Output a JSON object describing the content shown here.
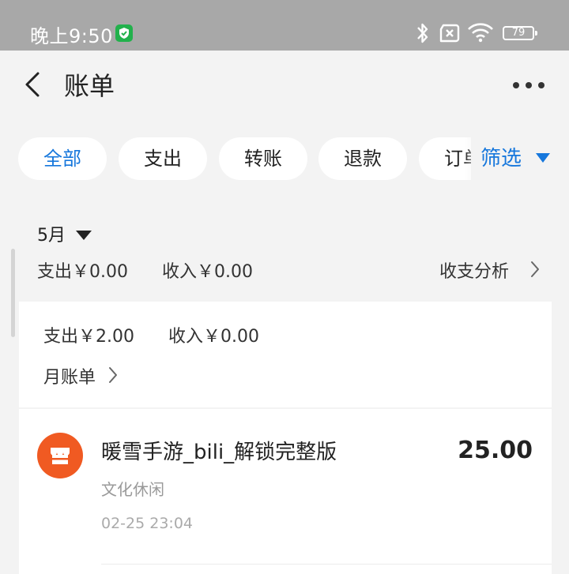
{
  "status_bar": {
    "time": "晚上9:50",
    "battery": "79",
    "icons": [
      "shield-icon",
      "bluetooth-icon",
      "no-sim-icon",
      "wifi-icon",
      "battery-icon"
    ]
  },
  "header": {
    "title": "账单",
    "icons": [
      "back-arrow-icon",
      "more-dots-icon"
    ]
  },
  "tabs": [
    {
      "label": "全部",
      "active": true
    },
    {
      "label": "支出",
      "active": false
    },
    {
      "label": "转账",
      "active": false
    },
    {
      "label": "退款",
      "active": false
    },
    {
      "label": "订单",
      "active": false
    }
  ],
  "filter": {
    "label": "筛选",
    "icon": "triangle-down-icon"
  },
  "colors": {
    "accent": "#1677dc",
    "merchant": "#f05a22",
    "background": "#f3f3f3"
  },
  "month_section": {
    "month": "5月",
    "expense": "支出￥0.00",
    "income": "收入￥0.00",
    "analysis_link": "收支分析"
  },
  "summary_card": {
    "expense": "支出￥2.00",
    "income": "收入￥0.00",
    "monthly_bill_link": "月账单"
  },
  "transactions": [
    {
      "title": "暖雪手游_bili_解锁完整版",
      "amount": "25.00",
      "category": "文化休闲",
      "time": "02-25 23:04",
      "icon": "store-icon"
    }
  ]
}
